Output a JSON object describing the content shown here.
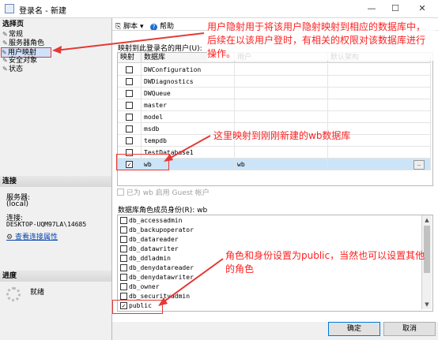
{
  "window": {
    "title": "登录名 - 新建",
    "minimize": "—",
    "maximize": "☐",
    "close": "✕"
  },
  "left": {
    "pages_header": "选择页",
    "pages": [
      "常规",
      "服务器角色",
      "用户映射",
      "安全对象",
      "状态"
    ],
    "connection_header": "连接",
    "server_label": "服务器:",
    "server_value": "(local)",
    "connection_label": "连接:",
    "connection_value": "DESKTOP-UQM97LA\\14685",
    "view_link": "查看连接属性",
    "progress_header": "进度",
    "progress_status": "就绪"
  },
  "toolbar": {
    "script": "脚本",
    "help": "帮助"
  },
  "mapping": {
    "label": "映射到此登录名的用户(U):",
    "columns": [
      "映射",
      "数据库",
      "用户",
      "默认架构"
    ],
    "rows": [
      {
        "mapped": false,
        "db": "DWConfiguration",
        "user": "",
        "schema": ""
      },
      {
        "mapped": false,
        "db": "DWDiagnostics",
        "user": "",
        "schema": ""
      },
      {
        "mapped": false,
        "db": "DWQueue",
        "user": "",
        "schema": ""
      },
      {
        "mapped": false,
        "db": "master",
        "user": "",
        "schema": ""
      },
      {
        "mapped": false,
        "db": "model",
        "user": "",
        "schema": ""
      },
      {
        "mapped": false,
        "db": "msdb",
        "user": "",
        "schema": ""
      },
      {
        "mapped": false,
        "db": "tempdb",
        "user": "",
        "schema": ""
      },
      {
        "mapped": false,
        "db": "TestDatabase1",
        "user": "",
        "schema": ""
      },
      {
        "mapped": true,
        "db": "wb",
        "user": "wb",
        "schema": ""
      }
    ],
    "ellipsis": ".."
  },
  "guest": "已为 wb 启用 Guest 帐户",
  "roles": {
    "label": "数据库角色成员身份(R): wb",
    "items": [
      {
        "name": "db_accessadmin",
        "checked": false
      },
      {
        "name": "db_backupoperator",
        "checked": false
      },
      {
        "name": "db_datareader",
        "checked": false
      },
      {
        "name": "db_datawriter",
        "checked": false
      },
      {
        "name": "db_ddladmin",
        "checked": false
      },
      {
        "name": "db_denydatareader",
        "checked": false
      },
      {
        "name": "db_denydatawriter",
        "checked": false
      },
      {
        "name": "db_owner",
        "checked": false
      },
      {
        "name": "db_securityadmin",
        "checked": false
      },
      {
        "name": "public",
        "checked": true
      }
    ]
  },
  "buttons": {
    "ok": "确定",
    "cancel": "取消"
  },
  "annotations": {
    "top": [
      "用户隐射用于将该用户隐射映射到相应的数据库中，",
      "后续在以该用户登时，有相关的权限对该数据库进行",
      "操作。"
    ],
    "middle": "这里映射到刚刚新建的wb数据库",
    "bottom": [
      "角色和身份设置为public，当然也可以设置其他",
      "的角色"
    ]
  },
  "colors": {
    "annotation": "#ff2020",
    "selection": "#cce4f7",
    "link": "#0645ad"
  }
}
